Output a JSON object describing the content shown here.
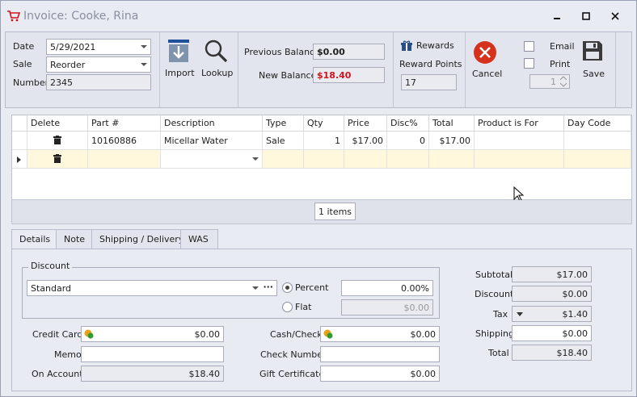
{
  "window": {
    "title": "Invoice: Cooke, Rina"
  },
  "toolbar": {
    "date_label": "Date",
    "date_value": "5/29/2021",
    "sale_label": "Sale",
    "sale_value": "Reorder",
    "number_label": "Number",
    "number_value": "2345",
    "import_label": "Import",
    "lookup_label": "Lookup",
    "prev_balance_label": "Previous Balance",
    "prev_balance_value": "$0.00",
    "new_balance_label": "New Balance",
    "new_balance_value": "$18.40",
    "rewards_label": "Rewards",
    "reward_points_label": "Reward Points",
    "reward_points_value": "17",
    "cancel_label": "Cancel",
    "email_label": "Email",
    "print_label": "Print",
    "copies_value": "1",
    "save_label": "Save"
  },
  "grid": {
    "columns": [
      "Delete",
      "Part #",
      "Description",
      "Type",
      "Qty",
      "Price",
      "Disc%",
      "Total",
      "Product is For",
      "Day Code"
    ],
    "rows": [
      {
        "part": "10160886",
        "description": "Micellar Water",
        "type": "Sale",
        "qty": "1",
        "price": "$17.00",
        "disc": "0",
        "total": "$17.00",
        "product_for": "",
        "day_code": ""
      }
    ],
    "items_count": "1 items"
  },
  "tabs": [
    "Details",
    "Note",
    "Shipping / Delivery",
    "WAS"
  ],
  "details": {
    "discount_group": "Discount",
    "discount_value": "Standard",
    "percent_label": "Percent",
    "percent_value": "0.00%",
    "flat_label": "Flat",
    "flat_value": "$0.00",
    "credit_card_label": "Credit Card",
    "credit_card_value": "$0.00",
    "memo_label": "Memo",
    "memo_value": "",
    "on_account_label": "On Account",
    "on_account_value": "$18.40",
    "cash_check_label": "Cash/Check",
    "cash_check_value": "$0.00",
    "check_number_label": "Check Number",
    "check_number_value": "",
    "gift_cert_label": "Gift Certificate",
    "gift_cert_value": "$0.00"
  },
  "totals": {
    "subtotal_label": "Subtotal",
    "subtotal_value": "$17.00",
    "discount_label": "Discount",
    "discount_value": "$0.00",
    "tax_label": "Tax",
    "tax_value": "$1.40",
    "shipping_label": "Shipping",
    "shipping_value": "$0.00",
    "total_label": "Total",
    "total_value": "$18.40"
  },
  "colors": {
    "accent_red": "#d0141e",
    "new_row": "#fff8dc"
  }
}
